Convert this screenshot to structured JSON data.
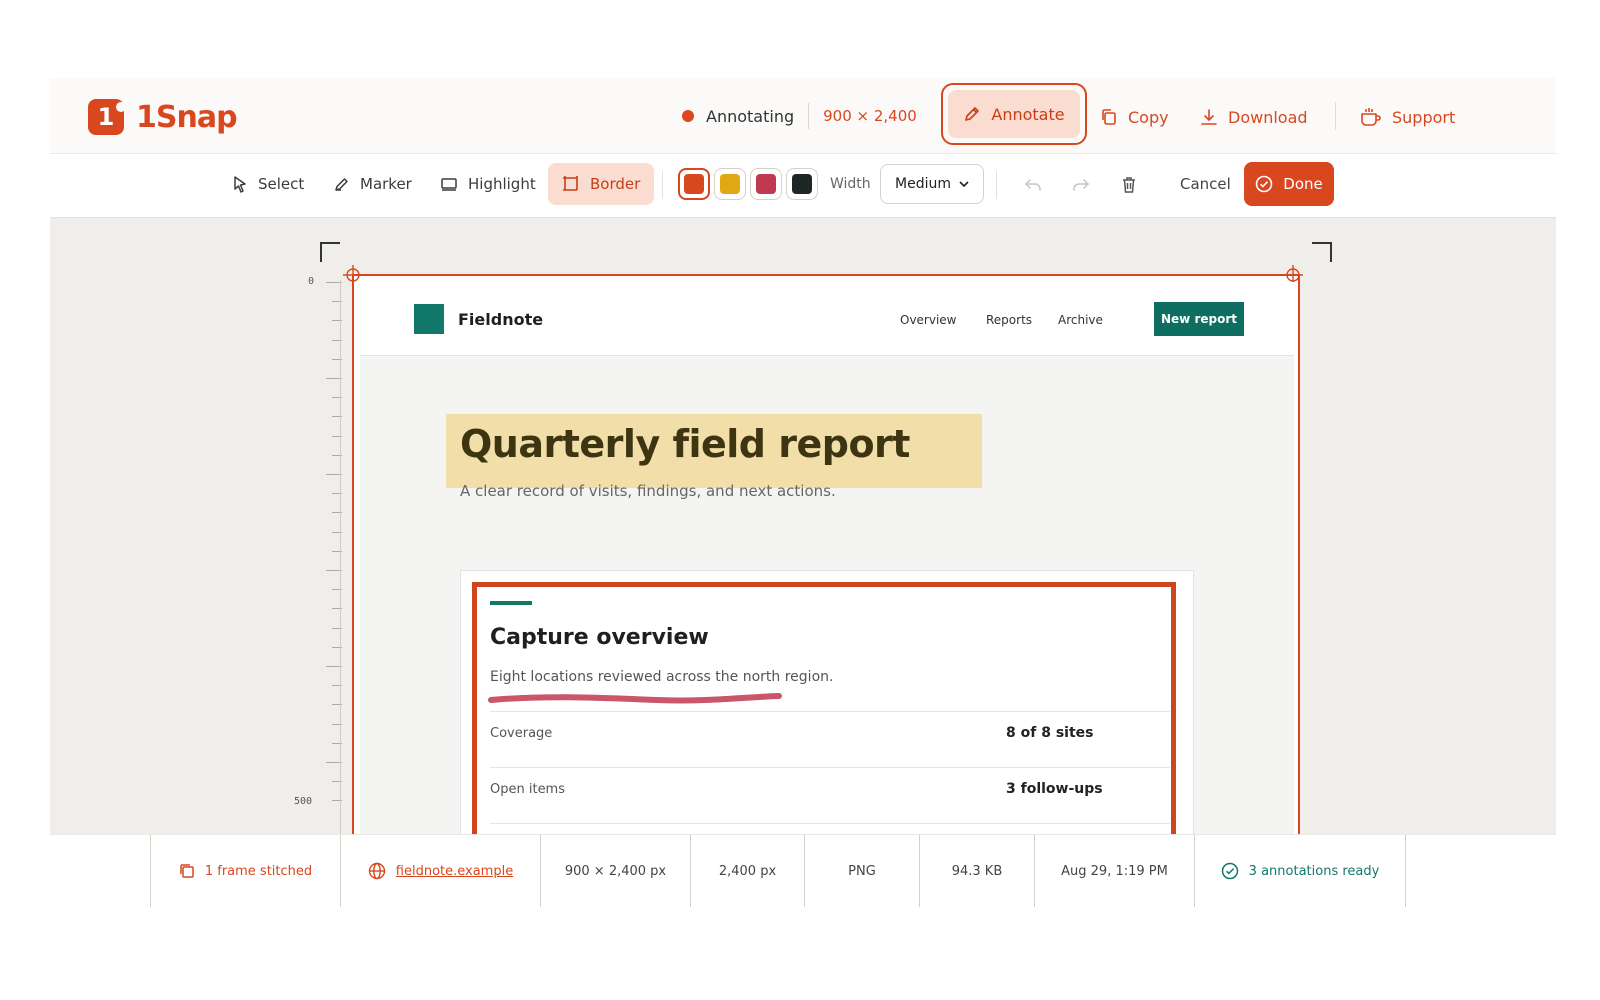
{
  "app": {
    "name": "1Snap"
  },
  "header": {
    "status_label": "Annotating",
    "status_dimensions": "900 × 2,400",
    "annotate_label": "Annotate",
    "copy_label": "Copy",
    "download_label": "Download",
    "support_label": "Support"
  },
  "toolbar": {
    "tools": [
      {
        "label": "Select",
        "icon": "cursor-icon"
      },
      {
        "label": "Marker",
        "icon": "pen-icon"
      },
      {
        "label": "Highlight",
        "icon": "highlight-icon"
      },
      {
        "label": "Border",
        "icon": "border-icon",
        "active": true
      }
    ],
    "colors": [
      "#d9471e",
      "#e2a813",
      "#c0394f",
      "#1f2726"
    ],
    "width_label": "Width",
    "width_value": "Medium",
    "cancel_label": "Cancel",
    "done_label": "Done"
  },
  "canvas": {
    "ruler_marks": [
      "0",
      "500"
    ]
  },
  "page": {
    "brand": "Fieldnote",
    "nav": [
      "Overview",
      "Reports",
      "Archive"
    ],
    "cta": "New report",
    "title": "Quarterly field report",
    "subtitle": "A clear record of visits, findings, and next actions.",
    "card": {
      "title": "Capture overview",
      "description": "Eight locations reviewed across the north region.",
      "rows": [
        {
          "label": "Coverage",
          "value": "8 of 8 sites"
        },
        {
          "label": "Open items",
          "value": "3 follow-ups"
        }
      ]
    }
  },
  "statusbar": {
    "frames": "1 frame stitched",
    "source": "fieldnote.example",
    "size": "900 × 2,400 px",
    "height": "2,400 px",
    "format": "PNG",
    "filesize": "94.3 KB",
    "timestamp": "Aug 29, 1:19 PM",
    "ready": "3 annotations ready"
  },
  "colors": {
    "accent": "#d9471e",
    "brand_green": "#12786a",
    "highlight": "#f1dea8",
    "marker": "#c0394f"
  }
}
